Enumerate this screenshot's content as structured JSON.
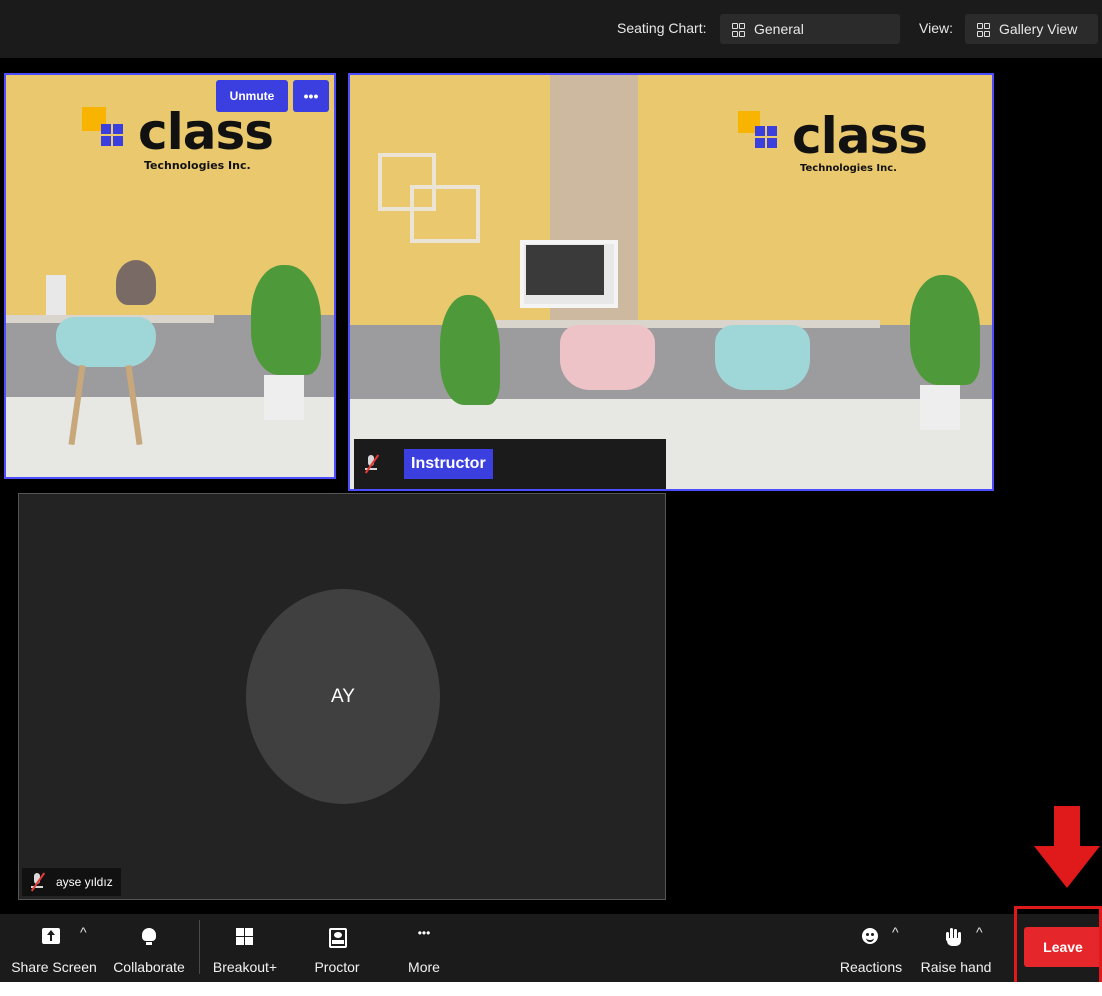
{
  "topbar": {
    "seating_label": "Seating Chart:",
    "seating_value": "General",
    "view_label": "View:",
    "view_value": "Gallery View"
  },
  "tiles": {
    "self": {
      "logo_word": "class",
      "logo_sub": "Technologies Inc.",
      "unmute_label": "Unmute",
      "more_label": "•••"
    },
    "instructor": {
      "logo_word": "class",
      "logo_sub": "Technologies Inc.",
      "name": "Instructor"
    },
    "participant": {
      "initials": "AY",
      "name": "ayse yıldız"
    }
  },
  "toolbar": {
    "share_screen": "Share Screen",
    "collaborate": "Collaborate",
    "breakout": "Breakout+",
    "proctor": "Proctor",
    "more": "More",
    "more_icon": "•••",
    "reactions": "Reactions",
    "raise_hand": "Raise hand",
    "leave": "Leave",
    "caret": "^"
  },
  "colors": {
    "accent": "#3b3fe0",
    "leave": "#e5262b",
    "annotation": "#e0191b"
  }
}
